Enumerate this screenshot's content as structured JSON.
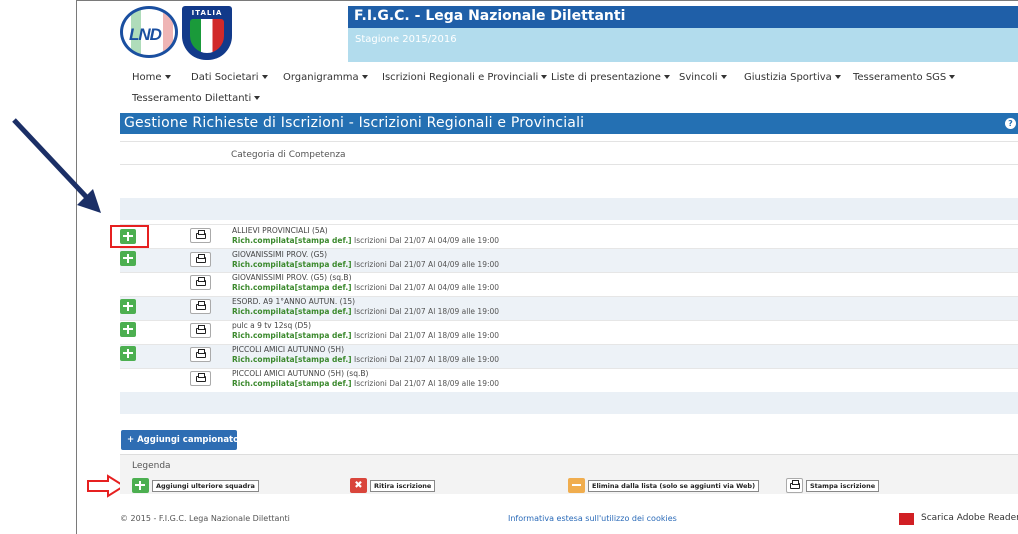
{
  "header": {
    "title": "F.I.G.C. - Lega Nazionale Dilettanti",
    "season": "Stagione 2015/2016",
    "logo_lnd_text": "LND",
    "logo_figc_text": "ITALIA",
    "colors": {
      "title_bar": "#1f5fa8",
      "season_box": "#b2dced"
    }
  },
  "nav": {
    "items": [
      {
        "label": "Home"
      },
      {
        "label": "Dati Societari"
      },
      {
        "label": "Organigramma"
      },
      {
        "label": "Iscrizioni Regionali e Provinciali"
      },
      {
        "label": "Liste di presentazione"
      },
      {
        "label": "Svincoli"
      },
      {
        "label": "Giustizia Sportiva"
      },
      {
        "label": "Tesseramento SGS"
      },
      {
        "label": "Tesseramento Dilettanti"
      }
    ]
  },
  "section": {
    "title": "Gestione Richieste di Iscrizioni - Iscrizioni Regionali e Provinciali",
    "help_icon": "question-icon"
  },
  "table": {
    "column_header": "Categoria di Competenza",
    "rows": [
      {
        "name": "ALLIEVI PROVINCIALI (5A)",
        "status": "Rich.compilata[stampa def.]",
        "info": "Iscrizioni Dal 21/07 Al 04/09 alle 19:00",
        "has_add": true
      },
      {
        "name": "GIOVANISSIMI PROV. (G5)",
        "status": "Rich.compilata[stampa def.]",
        "info": "Iscrizioni Dal 21/07 Al 04/09 alle 19:00",
        "has_add": true
      },
      {
        "name": "GIOVANISSIMI PROV. (G5) (sq.B)",
        "status": "Rich.compilata[stampa def.]",
        "info": "Iscrizioni Dal 21/07 Al 04/09 alle 19:00",
        "has_add": false
      },
      {
        "name": "ESORD. A9 1°ANNO AUTUN. (15)",
        "status": "Rich.compilata[stampa def.]",
        "info": "Iscrizioni Dal 21/07 Al 18/09 alle 19:00",
        "has_add": true
      },
      {
        "name": "pulc a 9 tv 12sq (D5)",
        "status": "Rich.compilata[stampa def.]",
        "info": "Iscrizioni Dal 21/07 Al 18/09 alle 19:00",
        "has_add": true
      },
      {
        "name": "PICCOLI AMICI AUTUNNO (5H)",
        "status": "Rich.compilata[stampa def.]",
        "info": "Iscrizioni Dal 21/07 Al 18/09 alle 19:00",
        "has_add": true
      },
      {
        "name": "PICCOLI AMICI AUTUNNO (5H) (sq.B)",
        "status": "Rich.compilata[stampa def.]",
        "info": "Iscrizioni Dal 21/07 Al 18/09 alle 19:00",
        "has_add": false
      }
    ]
  },
  "actions": {
    "add_campionato": "+ Aggiungi campionato"
  },
  "legend": {
    "title": "Legenda",
    "items": [
      {
        "icon": "plus-icon",
        "label": "Aggiungi ulteriore squadra"
      },
      {
        "icon": "x-icon",
        "label": "Ritira iscrizione"
      },
      {
        "icon": "minus-icon",
        "label": "Elimina dalla lista (solo se aggiunti via Web)"
      },
      {
        "icon": "printer-icon",
        "label": "Stampa iscrizione"
      }
    ]
  },
  "footer": {
    "copyright": "© 2015 - F.I.G.C. Lega Nazionale Dilettanti",
    "cookie_link": "Informativa estesa sull'utilizzo dei cookies",
    "adobe_link": "Scarica Adobe Reader"
  }
}
